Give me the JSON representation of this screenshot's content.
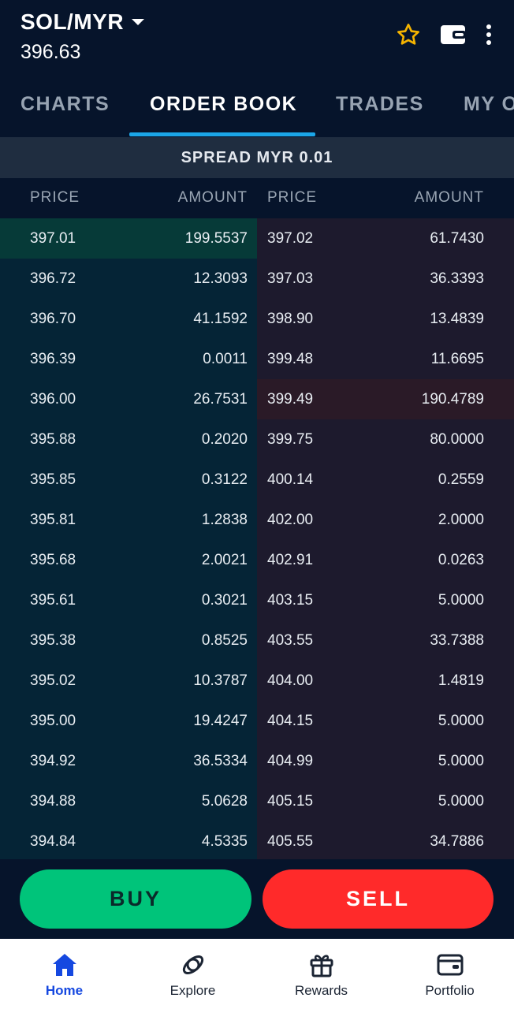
{
  "header": {
    "pair": "SOL/MYR",
    "price": "396.63"
  },
  "tabs": [
    {
      "label": "CHARTS",
      "active": false
    },
    {
      "label": "ORDER BOOK",
      "active": true
    },
    {
      "label": "TRADES",
      "active": false
    },
    {
      "label": "MY ORDERS",
      "active": false
    }
  ],
  "spread": "SPREAD MYR 0.01",
  "columns": {
    "bid_price": "PRICE",
    "bid_amount": "AMOUNT",
    "ask_price": "PRICE",
    "ask_amount": "AMOUNT"
  },
  "bids": [
    {
      "price": "397.01",
      "amount": "199.5537"
    },
    {
      "price": "396.72",
      "amount": "12.3093"
    },
    {
      "price": "396.70",
      "amount": "41.1592"
    },
    {
      "price": "396.39",
      "amount": "0.0011"
    },
    {
      "price": "396.00",
      "amount": "26.7531"
    },
    {
      "price": "395.88",
      "amount": "0.2020"
    },
    {
      "price": "395.85",
      "amount": "0.3122"
    },
    {
      "price": "395.81",
      "amount": "1.2838"
    },
    {
      "price": "395.68",
      "amount": "2.0021"
    },
    {
      "price": "395.61",
      "amount": "0.3021"
    },
    {
      "price": "395.38",
      "amount": "0.8525"
    },
    {
      "price": "395.02",
      "amount": "10.3787"
    },
    {
      "price": "395.00",
      "amount": "19.4247"
    },
    {
      "price": "394.92",
      "amount": "36.5334"
    },
    {
      "price": "394.88",
      "amount": "5.0628"
    },
    {
      "price": "394.84",
      "amount": "4.5335"
    }
  ],
  "asks": [
    {
      "price": "397.02",
      "amount": "61.7430"
    },
    {
      "price": "397.03",
      "amount": "36.3393"
    },
    {
      "price": "398.90",
      "amount": "13.4839"
    },
    {
      "price": "399.48",
      "amount": "11.6695"
    },
    {
      "price": "399.49",
      "amount": "190.4789"
    },
    {
      "price": "399.75",
      "amount": "80.0000"
    },
    {
      "price": "400.14",
      "amount": "0.2559"
    },
    {
      "price": "402.00",
      "amount": "2.0000"
    },
    {
      "price": "402.91",
      "amount": "0.0263"
    },
    {
      "price": "403.15",
      "amount": "5.0000"
    },
    {
      "price": "403.55",
      "amount": "33.7388"
    },
    {
      "price": "404.00",
      "amount": "1.4819"
    },
    {
      "price": "404.15",
      "amount": "5.0000"
    },
    {
      "price": "404.99",
      "amount": "5.0000"
    },
    {
      "price": "405.15",
      "amount": "5.0000"
    },
    {
      "price": "405.55",
      "amount": "34.7886"
    }
  ],
  "actions": {
    "buy": "BUY",
    "sell": "SELL"
  },
  "nav": [
    {
      "label": "Home",
      "icon": "home-icon",
      "active": true
    },
    {
      "label": "Explore",
      "icon": "explore-icon",
      "active": false
    },
    {
      "label": "Rewards",
      "icon": "gift-icon",
      "active": false
    },
    {
      "label": "Portfolio",
      "icon": "wallet-icon",
      "active": false
    }
  ],
  "colors": {
    "background": "#06142b",
    "accent_tab": "#1ba6e8",
    "buy": "#00c47a",
    "sell": "#ff2a2a",
    "star": "#f5b400",
    "nav_active": "#1548e0"
  }
}
